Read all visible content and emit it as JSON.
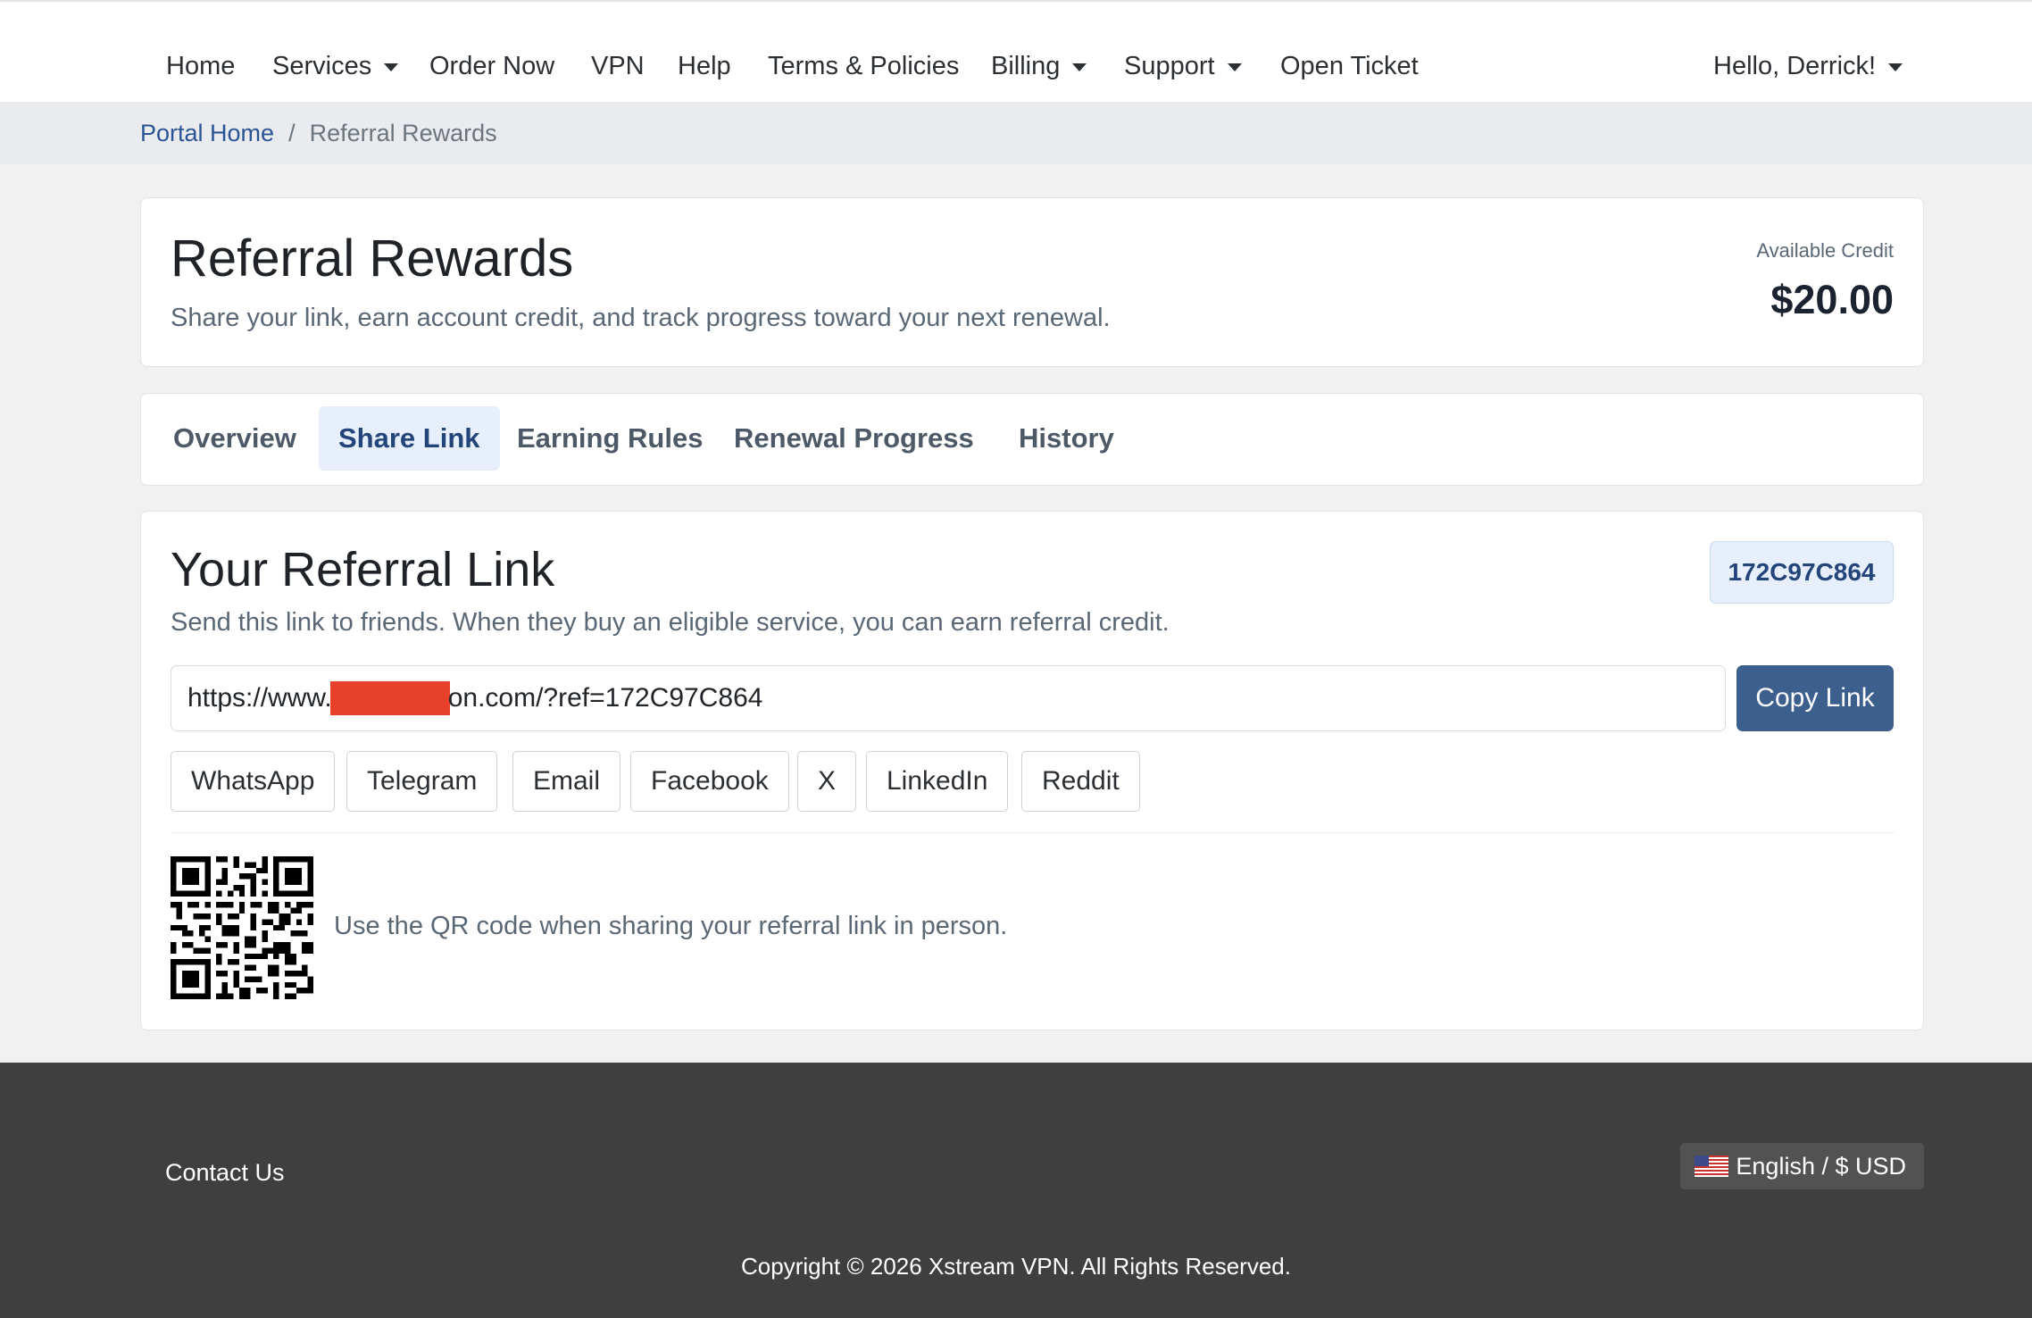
{
  "nav": {
    "items": [
      {
        "label": "Home"
      },
      {
        "label": "Services"
      },
      {
        "label": "Order Now"
      },
      {
        "label": "VPN"
      },
      {
        "label": "Help"
      },
      {
        "label": "Terms & Policies"
      },
      {
        "label": "Billing"
      },
      {
        "label": "Support"
      },
      {
        "label": "Open Ticket"
      }
    ],
    "user_menu": "Hello, Derrick!"
  },
  "breadcrumb": {
    "home": "Portal Home",
    "separator": "/",
    "current": "Referral Rewards"
  },
  "header": {
    "title": "Referral Rewards",
    "subtitle": "Share your link, earn account credit, and track progress toward your next renewal.",
    "credit_label": "Available Credit",
    "credit_value": "$20.00"
  },
  "tabs": [
    {
      "label": "Overview"
    },
    {
      "label": "Share Link",
      "active": true
    },
    {
      "label": "Earning Rules"
    },
    {
      "label": "Renewal Progress"
    },
    {
      "label": "History"
    }
  ],
  "referral": {
    "title": "Your Referral Link",
    "code": "172C97C864",
    "description": "Send this link to friends. When they buy an eligible service, you can earn referral credit.",
    "link_prefix": "https://www.",
    "link_suffix": "on.com/?ref=172C97C864",
    "copy_label": "Copy Link",
    "share_buttons": [
      "WhatsApp",
      "Telegram",
      "Email",
      "Facebook",
      "X",
      "LinkedIn",
      "Reddit"
    ],
    "qr_text": "Use the QR code when sharing your referral link in person."
  },
  "footer": {
    "contact": "Contact Us",
    "language": "English / $ USD",
    "copyright": "Copyright © 2026 Xstream VPN. All Rights Reserved."
  },
  "colors": {
    "primary": "#3d5f8e",
    "active_tab_bg": "#e6effb",
    "link": "#2a5494",
    "footer_bg": "#3f3f3f",
    "redaction": "#e8412a"
  }
}
